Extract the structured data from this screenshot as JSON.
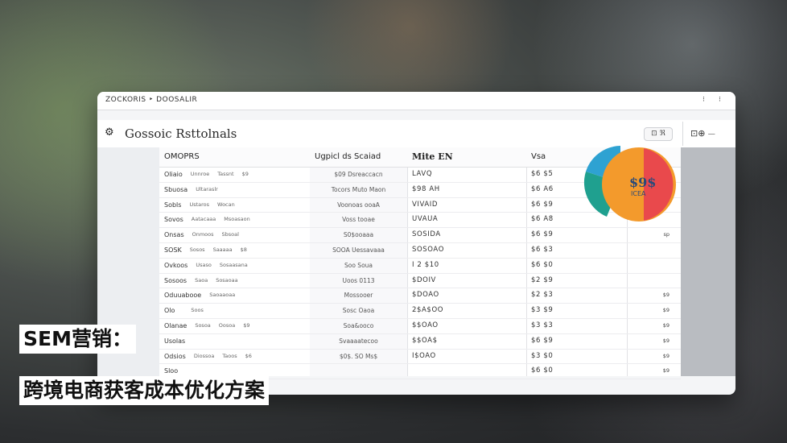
{
  "window": {
    "title": "ZOCKORIS ‣ DOOSALIR",
    "controls": [
      "⁝",
      "⁝"
    ]
  },
  "app": {
    "name": "Gossoic Rsttolnals",
    "toolbar_pill": "⊡ ℜ",
    "right_label": "⊡⊕ ⏤"
  },
  "table": {
    "headers": [
      "OMOPRS",
      "Ugpicl ds Scaiad",
      "Mite EN",
      "Vsa"
    ],
    "rows": [
      {
        "name": "Oliaio",
        "a": "Unnroe",
        "b": "Tassnt",
        "c": "$9",
        "mid": "$09 Dsreaccacn",
        "code": "LAVQ",
        "val": "$6 $5",
        "tail": ""
      },
      {
        "name": "Sbuosa",
        "a": "Ultaraslr",
        "b": "",
        "c": "",
        "mid": "Tocors Muto Maon",
        "code": "$98 AH",
        "val": "$6 A6",
        "tail": ""
      },
      {
        "name": "Sobls",
        "a": "Ustaros",
        "b": "Wocan",
        "c": "",
        "mid": "Voonoas ooaA",
        "code": "VIVAID",
        "val": "$6 $9",
        "tail": ""
      },
      {
        "name": "Sovos",
        "a": "Aatacaaa",
        "b": "Msoasaon",
        "c": "",
        "mid": "Voss tooae",
        "code": "UVAUA",
        "val": "$6 A8",
        "tail": ""
      },
      {
        "name": "Onsas",
        "a": "Onmoos",
        "b": "Sbsoal",
        "c": "",
        "mid": "S0$ooaaa",
        "code": "SOSIDA",
        "val": "$6 $9",
        "tail": "sp"
      },
      {
        "name": "SOSK",
        "a": "Sosos",
        "b": "Saaaaa",
        "c": "$8",
        "mid": "SOOA Uessavaaa",
        "code": "SOSOAO",
        "val": "$6 $3",
        "tail": ""
      },
      {
        "name": "Ovkoos",
        "a": "Usaso",
        "b": "Sosaasana",
        "c": "",
        "mid": "Soo Soua",
        "code": "I 2 $10",
        "val": "$6 $0",
        "tail": ""
      },
      {
        "name": "Sosoos",
        "a": "Saoa",
        "b": "Sosaoaa",
        "c": "",
        "mid": "Uoos 0113",
        "code": "$DOIV",
        "val": "$2 $9",
        "tail": ""
      },
      {
        "name": "Oduuabooe",
        "a": "Saoaaoaa",
        "b": "",
        "c": "",
        "mid": "Mossooer",
        "code": "$DOAO",
        "val": "$2 $3",
        "tail": "$9"
      },
      {
        "name": "Olo",
        "a": "",
        "b": "Soos",
        "c": "",
        "mid": "Sosc Oaoa",
        "code": "2$A$OO",
        "val": "$3 $9",
        "tail": "$9"
      },
      {
        "name": "Olanae",
        "a": "Sosoa",
        "b": "Oosoa",
        "c": "$9",
        "mid": "Soa&ooco",
        "code": "$$OAO",
        "val": "$3 $3",
        "tail": "$9"
      },
      {
        "name": "Usolas",
        "a": "",
        "b": "",
        "c": "",
        "mid": "Svaaaatecoo",
        "code": "$$OA$",
        "val": "$6 $9",
        "tail": "$9"
      },
      {
        "name": "Odsios",
        "a": "Diossoa",
        "b": "Taoos",
        "c": "$6",
        "mid": "$0$. SO Ms$",
        "code": "I$OAO",
        "val": "$3 $0",
        "tail": "$9"
      },
      {
        "name": "Sloo",
        "a": "",
        "b": "",
        "c": "",
        "mid": "",
        "code": "",
        "val": "$6 $0",
        "tail": "$9"
      }
    ]
  },
  "pie": {
    "label": "$9$",
    "sub": "ICEA",
    "colors": {
      "orange": "#f39a2c",
      "red": "#e9494c",
      "teal": "#1fa08f",
      "blue": "#2ea2d2"
    }
  },
  "overlay": {
    "title": "SEM营销：",
    "subtitle": "跨境电商获客成本优化方案"
  }
}
